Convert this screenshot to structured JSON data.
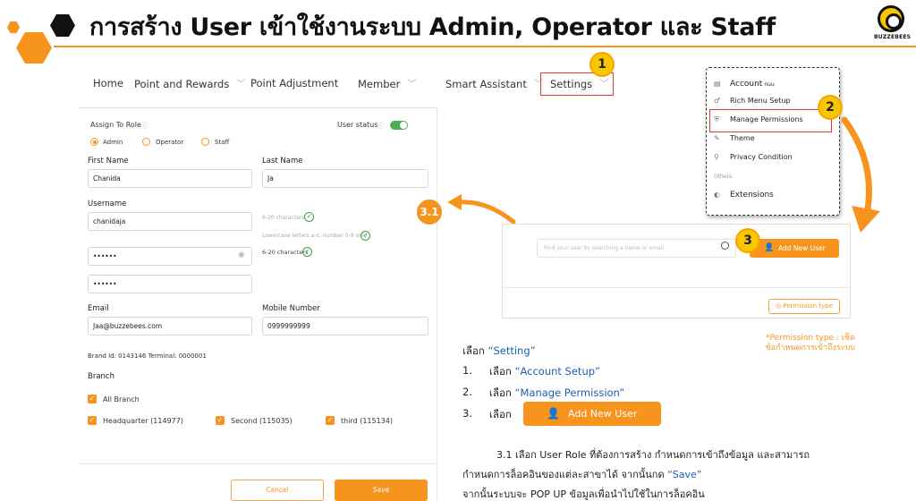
{
  "header": {
    "title": "การสร้าง User เข้าใช้งานระบบ Admin, Operator และ Staff",
    "logo_text": "BUZZEBEES"
  },
  "nav": {
    "items": [
      {
        "label": "Home"
      },
      {
        "label": "Point and Rewards"
      },
      {
        "label": "Point Adjustment"
      },
      {
        "label": "Member"
      },
      {
        "label": "Smart Assistant"
      },
      {
        "label": "Settings"
      }
    ]
  },
  "steps": {
    "s1": "1",
    "s2": "2",
    "s3": "3",
    "s31": "3.1"
  },
  "form": {
    "assign_role_label": "Assign To Role",
    "user_status_label": "User status",
    "roles": [
      {
        "label": "Admin",
        "selected": true
      },
      {
        "label": "Operator",
        "selected": false
      },
      {
        "label": "Staff",
        "selected": false
      }
    ],
    "first_name_label": "First Name",
    "first_name_value": "Chanida",
    "last_name_label": "Last Name",
    "last_name_value": "Ja",
    "username_label": "Username",
    "username_value": "chanidaja",
    "username_hint_1": "6-20 characters",
    "username_hint_2": "Lowercase letters a-z, number 0-9 only",
    "password_value": "••••••",
    "password_hint": "6-20 characters",
    "confirm_password_value": "••••••",
    "email_label": "Email",
    "email_value": "Jaa@buzzebees.com",
    "mobile_label": "Mobile Number",
    "mobile_value": "0999999999",
    "brand_info": "Brand Id: 0143146 Terminal: 0000001",
    "branch_label": "Branch",
    "branches": [
      {
        "label": "All Branch"
      },
      {
        "label": "Headquarter (114977)"
      },
      {
        "label": "Second (115035)"
      },
      {
        "label": "third (115134)"
      }
    ],
    "cancel_label": "Cancel",
    "save_label": "Save"
  },
  "menu": {
    "items": [
      {
        "label": "Account",
        "icon": "account-icon"
      },
      {
        "label": "Rich Menu Setup",
        "icon": "rich-menu-icon"
      },
      {
        "label": "Manage Permissions",
        "icon": "shield-icon"
      },
      {
        "label": "Theme",
        "icon": "theme-icon"
      },
      {
        "label": "Privacy Condition",
        "icon": "privacy-icon"
      }
    ],
    "others_label": "Others",
    "extensions_label": "Extensions",
    "overlap_text": "nuu"
  },
  "users": {
    "search_placeholder": "Find your user by searching a name or email",
    "add_label": "Add New User",
    "permission_type_label": "Permission type"
  },
  "note": {
    "line1": "*Permission type : เช็ค",
    "line2": "ข้อกำหนดการเข้าถึงระบบ"
  },
  "instructions": {
    "intro_prefix": "เลือก ",
    "intro_target": "“Setting”",
    "item1_num": "1.",
    "item1_prefix": "เลือก ",
    "item1_target": "“Account Setup”",
    "item2_num": "2.",
    "item2_prefix": "เลือก ",
    "item2_target": "“Manage Permission”",
    "item3_num": "3.",
    "item3_prefix": "เลือก",
    "add_button_label": "Add New User",
    "p1": "3.1 เลือก User Role ที่ต้องการสร้าง   กำหนดการเข้าถึงข้อมูล และสามารถ",
    "p2_prefix": "กำหนดการล็อคอินของแต่ละสาขาได้  จากนั้นกด ",
    "p2_target": "“Save”",
    "p3": "จากนั้นระบบจะ POP UP ข้อมูลเพื่อนำไปใช้ในการล็อคอิน"
  },
  "colors": {
    "accent": "#f7941d",
    "badge": "#f7c600",
    "highlight_box": "#e53935",
    "link_blue": "#1a5fb4",
    "success": "#43a047"
  }
}
